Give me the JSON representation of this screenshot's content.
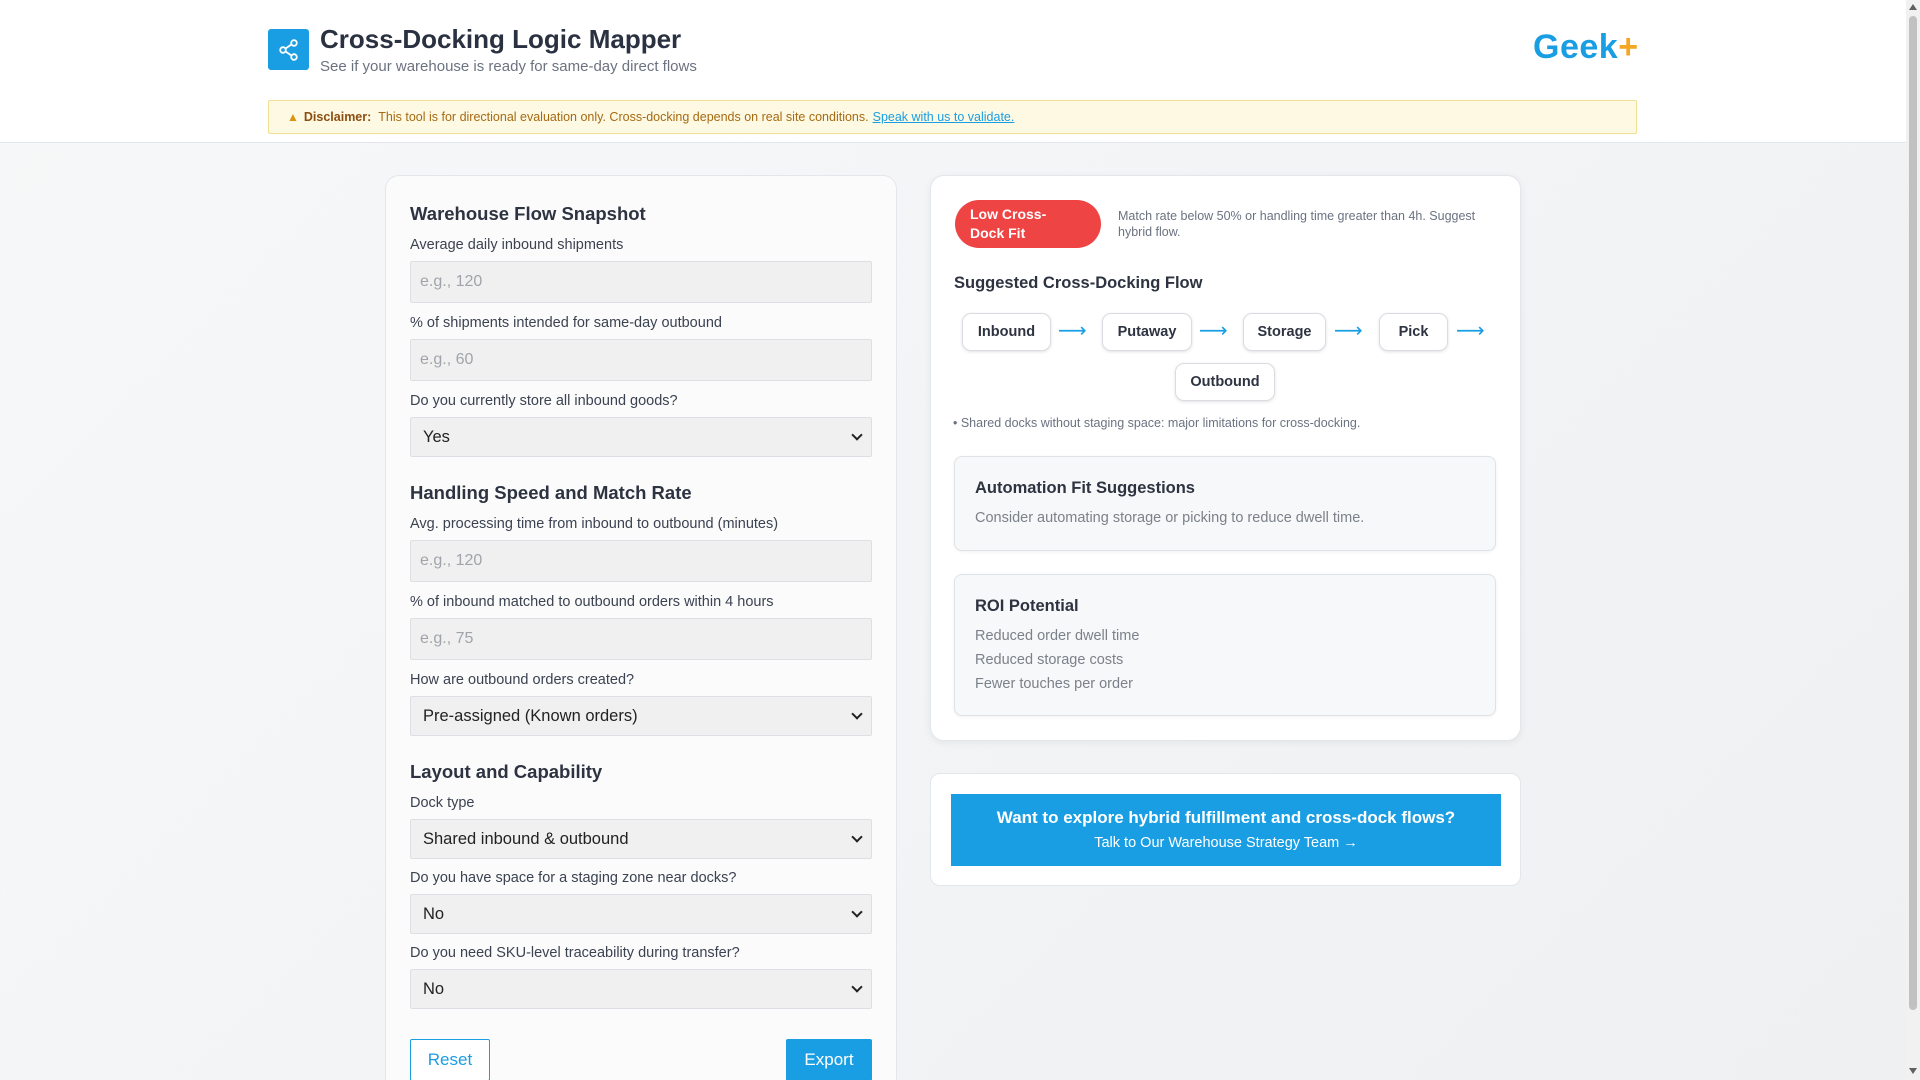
{
  "header": {
    "title": "Cross-Docking Logic Mapper",
    "subtitle": "See if your warehouse is ready for same-day direct flows",
    "brand_text": "Geek",
    "brand_plus": "+",
    "icon": "share-icon"
  },
  "disclaimer": {
    "label": "Disclaimer:",
    "text": "This tool is for directional evaluation only. Cross-docking depends on real site conditions.",
    "link": "Speak with us to validate.",
    "icon": "warning-icon"
  },
  "form": {
    "snapshot": {
      "title": "Warehouse Flow Snapshot",
      "inbound_label": "Average daily inbound shipments",
      "inbound_placeholder": "e.g., 120",
      "sameday_label": "% of shipments intended for same-day outbound",
      "sameday_placeholder": "e.g., 60",
      "store_label": "Do you currently store all inbound goods?",
      "store_value": "Yes"
    },
    "handling": {
      "title": "Handling Speed and Match Rate",
      "time_label": "Avg. processing time from inbound to outbound (minutes)",
      "time_placeholder": "e.g., 120",
      "match_label": "% of inbound matched to outbound orders within 4 hours",
      "match_placeholder": "e.g., 75",
      "orders_label": "How are outbound orders created?",
      "orders_value": "Pre-assigned (Known orders)"
    },
    "layout": {
      "title": "Layout and Capability",
      "dock_label": "Dock type",
      "dock_value": "Shared inbound & outbound",
      "staging_label": "Do you have space for a staging zone near docks?",
      "staging_value": "No",
      "sku_label": "Do you need SKU-level traceability during transfer?",
      "sku_value": "No"
    },
    "reset_label": "Reset",
    "export_label": "Export"
  },
  "result": {
    "badge_line1": "Low Cross-",
    "badge_line2": "Dock Fit",
    "badge_color": "#ee4444",
    "badge_note": "Match rate below 50% or handling time greater than 4h. Suggest hybrid flow.",
    "flow_title": "Suggested Cross-Docking Flow",
    "flow_steps": [
      "Inbound",
      "Putaway",
      "Storage",
      "Pick",
      "Outbound"
    ],
    "flow_arrow": "⟶",
    "flow_note": "• Shared docks without staging space: major limitations for cross-docking.",
    "automation": {
      "title": "Automation Fit Suggestions",
      "text": "Consider automating storage or picking to reduce dwell time."
    },
    "roi": {
      "title": "ROI Potential",
      "items": [
        "Reduced order dwell time",
        "Reduced storage costs",
        "Fewer touches per order"
      ]
    }
  },
  "cta": {
    "main": "Want to explore hybrid fulfillment and cross-dock flows?",
    "sub": "Talk to Our Warehouse Strategy Team →"
  },
  "colors": {
    "accent": "#1a9ee3",
    "danger": "#ee4444",
    "brand_plus": "#f5a623"
  }
}
